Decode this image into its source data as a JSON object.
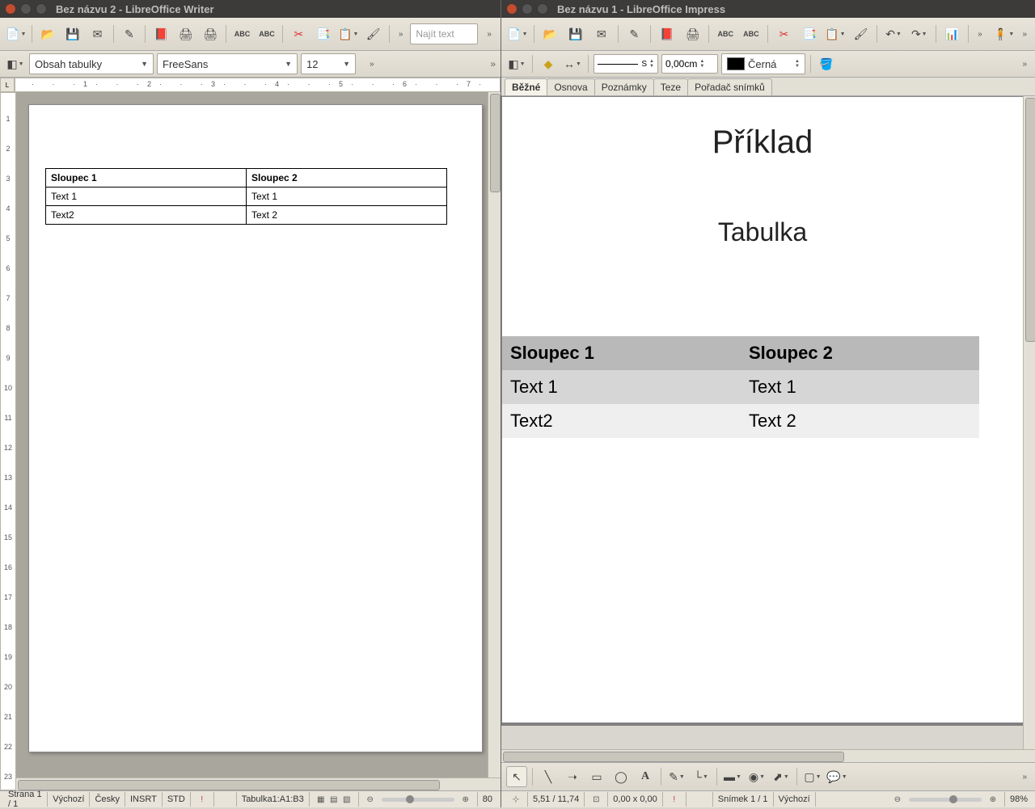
{
  "left": {
    "title": "Bez názvu 2 - LibreOffice Writer",
    "style_name": "Obsah tabulky",
    "font_name": "FreeSans",
    "font_size": "12",
    "search_placeholder": "Najít text",
    "table": {
      "headers": [
        "Sloupec 1",
        "Sloupec 2"
      ],
      "rows": [
        [
          "Text 1",
          "Text 1"
        ],
        [
          "Text2",
          "Text 2"
        ]
      ]
    },
    "ruler_ticks": "· · ·1· · ·2· · ·3· · ·4· · ·5· · ·6· · ·7· · ·8· · ·9· · ·10· · ·11· · ·12· · ·13· · ·14· · ·15· · ·16· · ·17· · ·18·",
    "status": {
      "page": "Strana 1 / 1",
      "style": "Výchozí",
      "lang": "Česky",
      "insert": "INSRT",
      "std": "STD",
      "selection": "Tabulka1:A1:B3",
      "zoom": "80"
    }
  },
  "right": {
    "title": "Bez názvu 1 - LibreOffice Impress",
    "line_width": "0,00cm",
    "line_end": "S",
    "color_name": "Černá",
    "tabs": [
      "Běžné",
      "Osnova",
      "Poznámky",
      "Teze",
      "Pořadač snímků"
    ],
    "slide": {
      "title": "Příklad",
      "subtitle": "Tabulka",
      "table": {
        "headers": [
          "Sloupec 1",
          "Sloupec 2"
        ],
        "rows": [
          [
            "Text 1",
            "Text 1"
          ],
          [
            "Text2",
            "Text 2"
          ]
        ]
      }
    },
    "status": {
      "coords": "5,51 / 11,74",
      "size": "0,00 x 0,00",
      "slide": "Snímek 1 / 1",
      "style": "Výchozí",
      "zoom": "98%"
    }
  }
}
